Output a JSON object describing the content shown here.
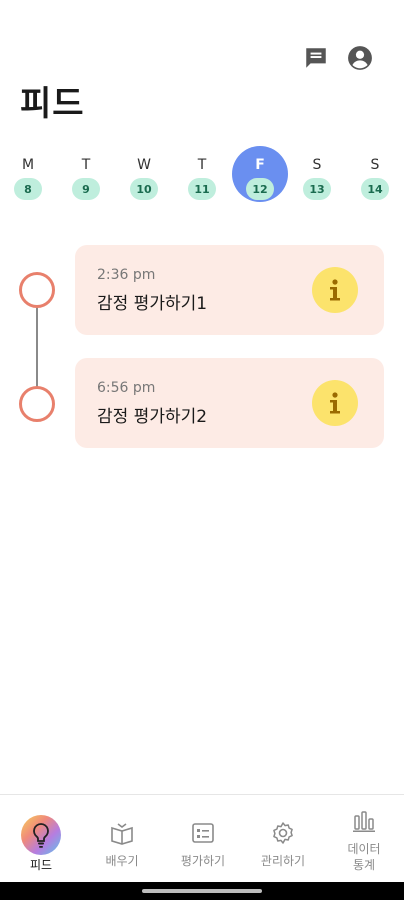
{
  "header": {
    "title": "피드",
    "actions": [
      {
        "name": "chat-icon"
      },
      {
        "name": "account-icon"
      }
    ]
  },
  "week": {
    "days": [
      {
        "dow": "M",
        "date": "8",
        "selected": false
      },
      {
        "dow": "T",
        "date": "9",
        "selected": false
      },
      {
        "dow": "W",
        "date": "10",
        "selected": false
      },
      {
        "dow": "T",
        "date": "11",
        "selected": false
      },
      {
        "dow": "F",
        "date": "12",
        "selected": true
      },
      {
        "dow": "S",
        "date": "13",
        "selected": false
      },
      {
        "dow": "S",
        "date": "14",
        "selected": false
      }
    ],
    "colors": {
      "selected": "#6a8ff0",
      "date_pill": "#bfeedd"
    }
  },
  "feed": {
    "entries": [
      {
        "time": "2:36 pm",
        "label": "감정 평가하기1",
        "icon": "info-icon"
      },
      {
        "time": "6:56 pm",
        "label": "감정 평가하기2",
        "icon": "info-icon"
      }
    ],
    "colors": {
      "card": "#fdebe5",
      "node": "#e8806c",
      "info": "#fce36c"
    }
  },
  "bottom_nav": {
    "items": [
      {
        "label": "피드",
        "icon": "lightbulb-icon",
        "active": true
      },
      {
        "label": "배우기",
        "icon": "book-icon",
        "active": false
      },
      {
        "label": "평가하기",
        "icon": "checklist-icon",
        "active": false
      },
      {
        "label": "관리하기",
        "icon": "gear-icon",
        "active": false
      },
      {
        "label": "데이터\n통계",
        "icon": "bar-chart-icon",
        "active": false
      }
    ]
  }
}
